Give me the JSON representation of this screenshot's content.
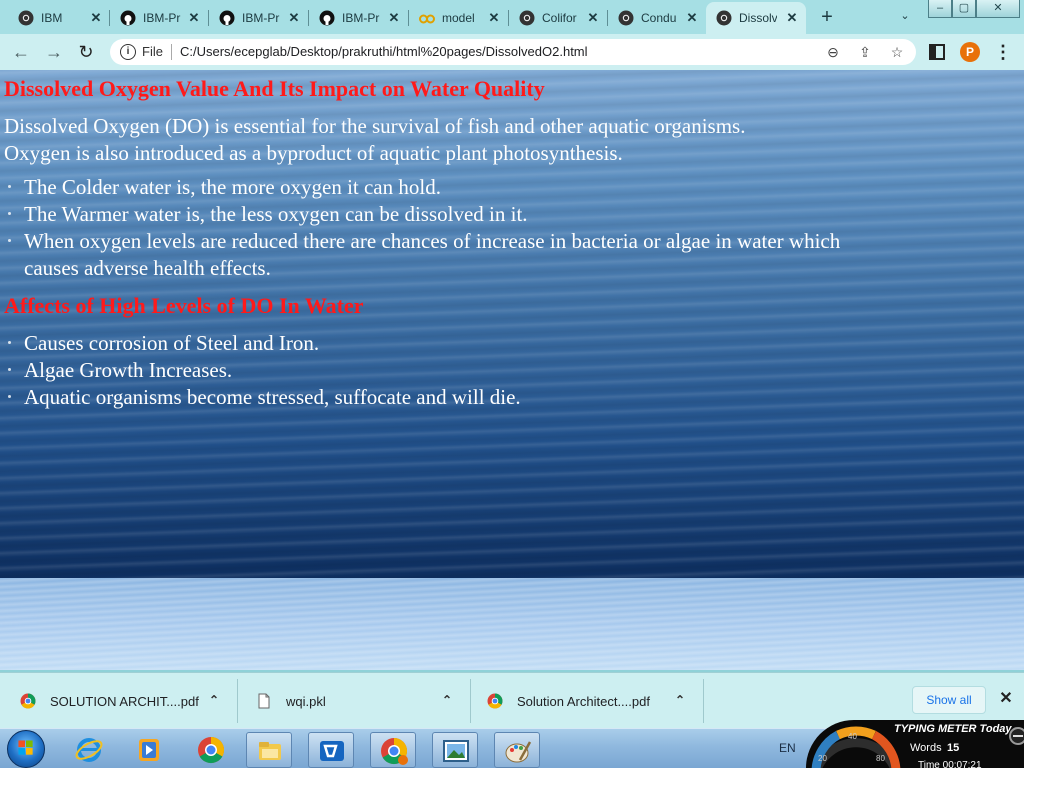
{
  "browser": {
    "tabs": [
      {
        "title": "IBM",
        "icon": "chrome-icon",
        "active": false
      },
      {
        "title": "IBM-Pr",
        "icon": "github-icon",
        "active": false
      },
      {
        "title": "IBM-Pr",
        "icon": "github-icon",
        "active": false
      },
      {
        "title": "IBM-Pr",
        "icon": "github-icon",
        "active": false
      },
      {
        "title": "model",
        "icon": "glasses-icon",
        "active": false
      },
      {
        "title": "Colifor",
        "icon": "chrome-icon",
        "active": false
      },
      {
        "title": "Condu",
        "icon": "chrome-icon",
        "active": false
      },
      {
        "title": "Dissolv",
        "icon": "chrome-icon",
        "active": true
      }
    ],
    "tab_close_glyph": "✕",
    "new_tab_glyph": "+",
    "tab_search_glyph": "⌄",
    "window_controls": {
      "minimize": "–",
      "maximize": "▢",
      "close": "✕"
    },
    "toolbar": {
      "back_glyph": "←",
      "forward_glyph": "→",
      "reload_glyph": "↻",
      "scheme_label": "File",
      "url": "C:/Users/ecepglab/Desktop/prakruthi/html%20pages/DissolvedO2.html",
      "zoom_glyph": "⊖",
      "share_glyph": "⇪",
      "bookmark_glyph": "☆",
      "profile_initial": "P",
      "menu_glyph": "⋮"
    }
  },
  "page": {
    "title": "Dissolved Oxygen Value And Its Impact on Water Quality",
    "intro": [
      "Dissolved Oxygen (DO) is essential for the survival of fish and other aquatic organisms.",
      "Oxygen is also introduced as a byproduct of aquatic plant photosynthesis."
    ],
    "points": [
      "The Colder water is, the more oxygen it can hold.",
      "The Warmer water is, the less oxygen can be dissolved in it.",
      "When oxygen levels are reduced there are chances of increase in bacteria or algae in water which",
      "causes adverse health effects."
    ],
    "section_heading": "Affects of High Levels of DO In Water",
    "effects": [
      "Causes corrosion of Steel and Iron.",
      "Algae Growth Increases.",
      "Aquatic organisms become stressed, suffocate and will die."
    ]
  },
  "downloads": {
    "items": [
      {
        "name": "SOLUTION ARCHIT....pdf",
        "icon": "chrome-pdf-icon"
      },
      {
        "name": "wqi.pkl",
        "icon": "file-icon"
      },
      {
        "name": "Solution Architect....pdf",
        "icon": "chrome-pdf-icon"
      }
    ],
    "caret_glyph": "⌃",
    "show_all_label": "Show all",
    "close_glyph": "✕"
  },
  "taskbar": {
    "apps": [
      "internet-explorer-icon",
      "media-player-icon",
      "chrome-icon",
      "file-explorer-icon",
      "vmware-icon",
      "chrome-profile-icon",
      "photo-viewer-icon",
      "paint-icon"
    ],
    "language": "EN"
  },
  "typing_meter": {
    "title": "TYPING METER Today",
    "words_label": "Words",
    "words_value": "15",
    "time_text": "Time 00:07:21",
    "gauge_labels": [
      "40",
      "20",
      "80"
    ]
  },
  "colors": {
    "heading_red": "#ff1a1a",
    "body_text": "#ffffff",
    "chrome_frame": "#a6dfe4",
    "toolbar": "#cdeff1"
  }
}
